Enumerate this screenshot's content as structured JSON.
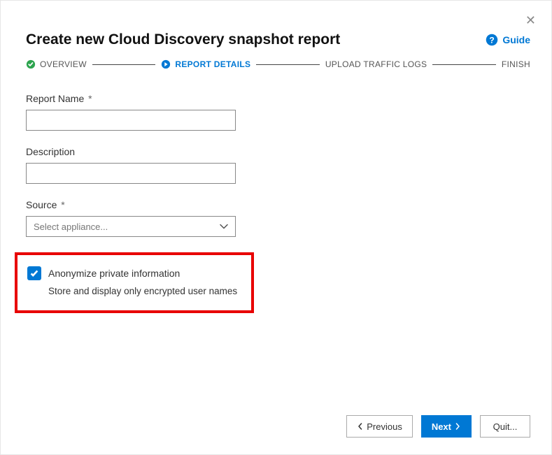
{
  "dialog": {
    "title": "Create new Cloud Discovery snapshot report",
    "guide_label": "Guide"
  },
  "stepper": {
    "steps": [
      {
        "label": "OVERVIEW",
        "state": "done"
      },
      {
        "label": "REPORT DETAILS",
        "state": "current"
      },
      {
        "label": "UPLOAD TRAFFIC LOGS",
        "state": "upcoming"
      },
      {
        "label": "FINISH",
        "state": "upcoming"
      }
    ]
  },
  "form": {
    "report_name": {
      "label": "Report Name",
      "required_mark": "*",
      "value": ""
    },
    "description": {
      "label": "Description",
      "value": ""
    },
    "source": {
      "label": "Source",
      "required_mark": "*",
      "placeholder": "Select appliance..."
    },
    "anonymize": {
      "checked": true,
      "label": "Anonymize private information",
      "sub": "Store and display only encrypted user names"
    }
  },
  "footer": {
    "previous": "Previous",
    "next": "Next",
    "quit": "Quit..."
  },
  "highlight_color": "#e80000",
  "accent_color": "#0078d4"
}
